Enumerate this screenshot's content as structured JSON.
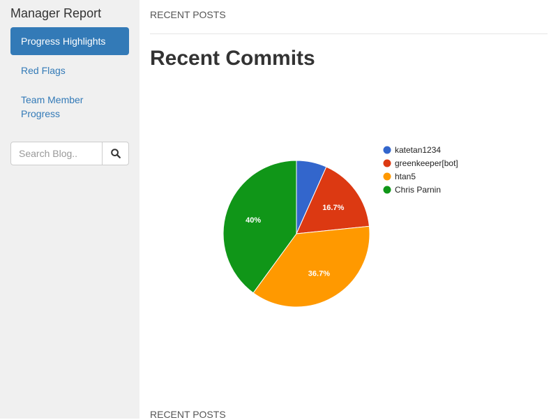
{
  "sidebar": {
    "title": "Manager Report",
    "nav": [
      {
        "label": "Progress Highlights",
        "active": true
      },
      {
        "label": "Red Flags",
        "active": false
      },
      {
        "label": "Team Member Progress",
        "active": false
      }
    ],
    "search": {
      "placeholder": "Search Blog..",
      "value": "",
      "button_icon": "search-icon"
    }
  },
  "main": {
    "top_heading": "RECENT POSTS",
    "title": "Recent Commits",
    "bottom_heading": "RECENT POSTS"
  },
  "colors": {
    "accent": "#337ab7",
    "sidebar_bg": "#f0f0f0"
  },
  "chart_data": {
    "type": "pie",
    "title": "",
    "legend_position": "right",
    "unit": "%",
    "slices": [
      {
        "label": "katetan1234",
        "value": 6.7,
        "color": "#3366cc",
        "show_label": false
      },
      {
        "label": "greenkeeper[bot]",
        "value": 16.7,
        "color": "#dc3912",
        "show_label": true
      },
      {
        "label": "htan5",
        "value": 36.7,
        "color": "#ff9900",
        "show_label": true
      },
      {
        "label": "Chris Parnin",
        "value": 40,
        "color": "#109618",
        "show_label": true
      }
    ]
  }
}
